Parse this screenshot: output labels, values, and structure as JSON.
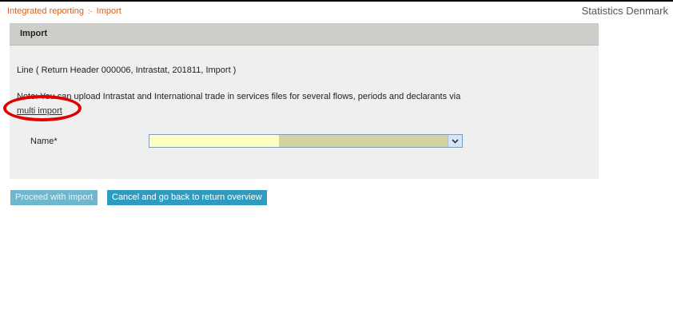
{
  "breadcrumb": {
    "items": [
      "Integrated reporting",
      "Import"
    ],
    "separator": ":-"
  },
  "brand": "Statistics Denmark",
  "panel": {
    "title": "Import",
    "line_text": "Line ( Return Header 000006, Intrastat, 201811, Import )",
    "note_text": "Note: You can upload Intrastat and International trade in services files for several flows, periods and declarants via",
    "multi_import_link": "multi import"
  },
  "form": {
    "name_label": "Name*",
    "name_value": ""
  },
  "buttons": {
    "proceed": "Proceed with import",
    "cancel": "Cancel and go back to return overview"
  },
  "colors": {
    "breadcrumb": "#d6601a",
    "panel_header": "#cfcdc9",
    "panel_bg": "#efefef",
    "button": "#2e9cc0",
    "button_disabled": "#6db8ce",
    "annotation_circle": "#e00000"
  },
  "icons": {
    "select_arrow": "chevron-down-icon"
  }
}
